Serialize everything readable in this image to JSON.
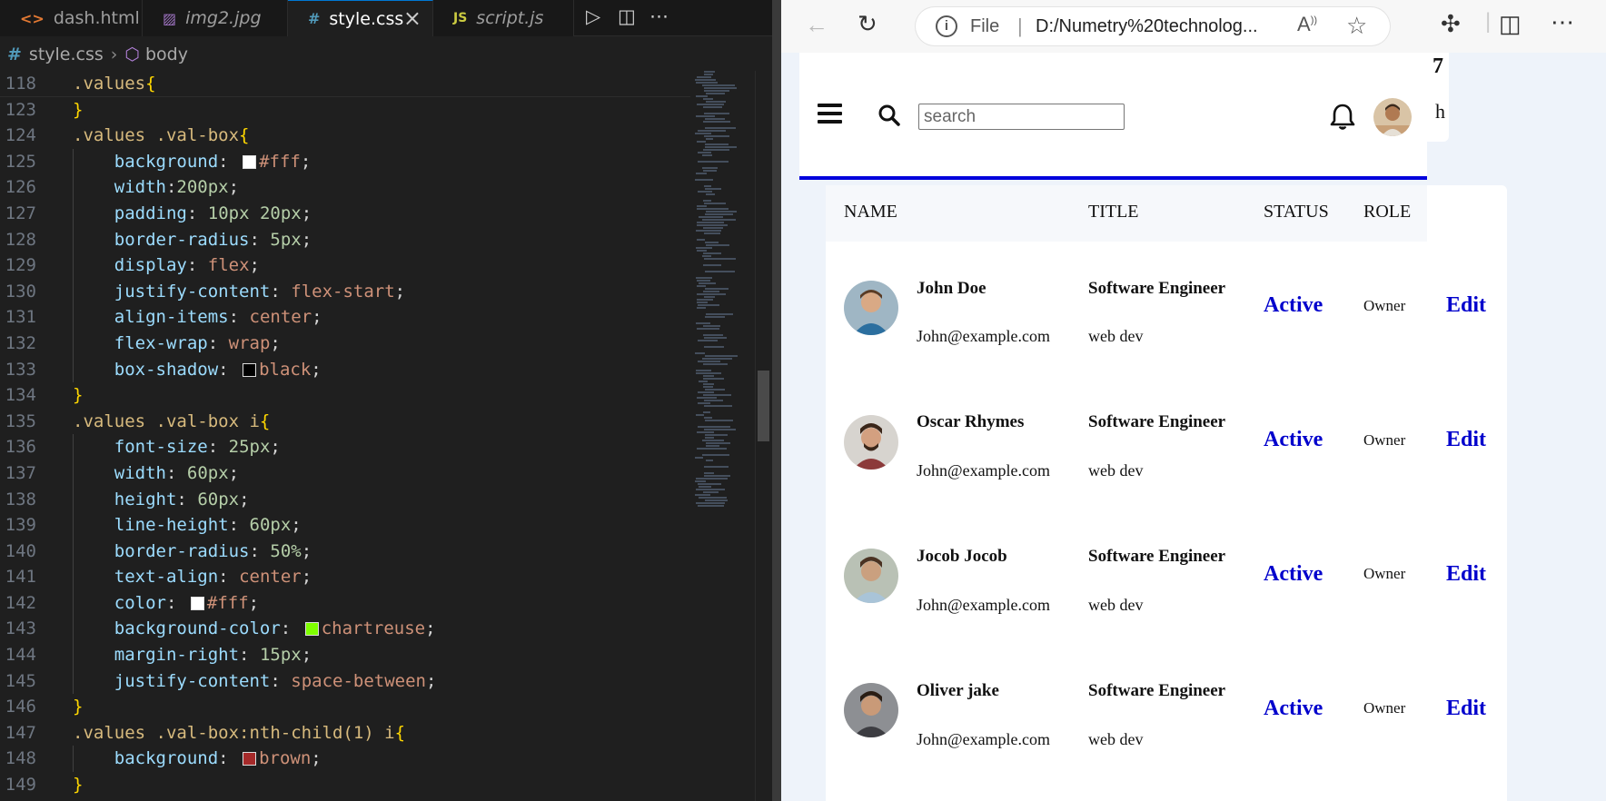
{
  "editor": {
    "tabs": [
      {
        "label": "dash.html",
        "icon": "html-icon"
      },
      {
        "label": "img2.jpg",
        "icon": "image-icon"
      },
      {
        "label": "style.css",
        "icon": "css-icon"
      },
      {
        "label": "script.js",
        "icon": "js-icon"
      }
    ],
    "active_tab": "style.css",
    "breadcrumb": {
      "file": "style.css",
      "symbol": "body"
    },
    "lines": [
      {
        "n": "118",
        "text": ".values{"
      },
      {
        "n": "123",
        "text": "}"
      },
      {
        "n": "124",
        "text": ".values .val-box{"
      },
      {
        "n": "125",
        "text": "    background: #fff;"
      },
      {
        "n": "126",
        "text": "    width:200px;"
      },
      {
        "n": "127",
        "text": "    padding: 10px 20px;"
      },
      {
        "n": "128",
        "text": "    border-radius: 5px;"
      },
      {
        "n": "129",
        "text": "    display: flex;"
      },
      {
        "n": "130",
        "text": "    justify-content: flex-start;"
      },
      {
        "n": "131",
        "text": "    align-items: center;"
      },
      {
        "n": "132",
        "text": "    flex-wrap: wrap;"
      },
      {
        "n": "133",
        "text": "    box-shadow: black;"
      },
      {
        "n": "134",
        "text": "}"
      },
      {
        "n": "135",
        "text": ".values .val-box i{"
      },
      {
        "n": "136",
        "text": "    font-size: 25px;"
      },
      {
        "n": "137",
        "text": "    width: 60px;"
      },
      {
        "n": "138",
        "text": "    height: 60px;"
      },
      {
        "n": "139",
        "text": "    line-height: 60px;"
      },
      {
        "n": "140",
        "text": "    border-radius: 50%;"
      },
      {
        "n": "141",
        "text": "    text-align: center;"
      },
      {
        "n": "142",
        "text": "    color: #fff;"
      },
      {
        "n": "143",
        "text": "    background-color: chartreuse;"
      },
      {
        "n": "144",
        "text": "    margin-right: 15px;"
      },
      {
        "n": "145",
        "text": "    justify-content: space-between;"
      },
      {
        "n": "146",
        "text": "}"
      },
      {
        "n": "147",
        "text": ".values .val-box:nth-child(1) i{"
      },
      {
        "n": "148",
        "text": "    background: brown;"
      },
      {
        "n": "149",
        "text": "}"
      }
    ],
    "swatch_colors": {
      "125": "#ffffff",
      "133": "#000000",
      "142": "#ffffff",
      "143": "#7fff00",
      "148": "#a52a2a"
    }
  },
  "browser": {
    "address": {
      "scheme_label": "File",
      "url": "D:/Numetry%20technolog..."
    },
    "page": {
      "peek_card": {
        "number": "7",
        "text": "h"
      },
      "search": {
        "placeholder": "search"
      },
      "table": {
        "headers": [
          "NAME",
          "TITLE",
          "STATUS",
          "ROLE"
        ],
        "rows": [
          {
            "name": "John Doe",
            "email": "John@example.com",
            "title": "Software Engineer",
            "sub": "web dev",
            "status": "Active",
            "role": "Owner",
            "action": "Edit"
          },
          {
            "name": "Oscar Rhymes",
            "email": "John@example.com",
            "title": "Software Engineer",
            "sub": "web dev",
            "status": "Active",
            "role": "Owner",
            "action": "Edit"
          },
          {
            "name": "Jocob Jocob",
            "email": "John@example.com",
            "title": "Software Engineer",
            "sub": "web dev",
            "status": "Active",
            "role": "Owner",
            "action": "Edit"
          },
          {
            "name": "Oliver jake",
            "email": "John@example.com",
            "title": "Software Engineer",
            "sub": "web dev",
            "status": "Active",
            "role": "Owner",
            "action": "Edit"
          }
        ]
      }
    },
    "colors": {
      "accent_border": "#0000dd",
      "status_link": "#0000cc"
    }
  }
}
